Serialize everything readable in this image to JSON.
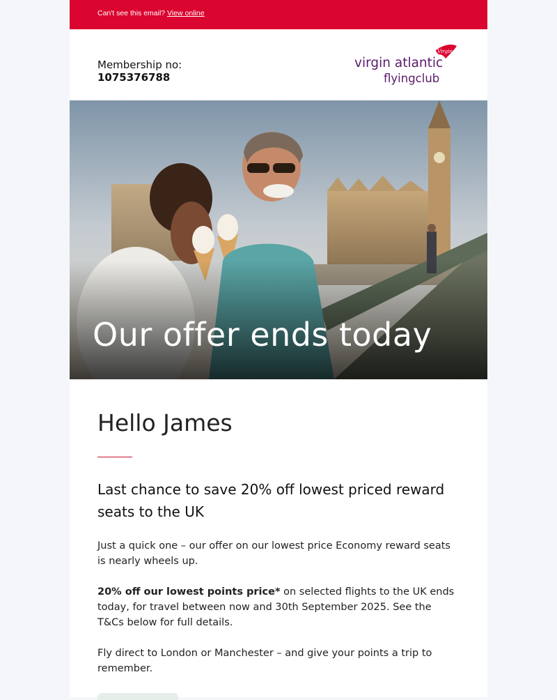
{
  "topbar": {
    "prefix": "Can't see this email?",
    "link": "View online"
  },
  "header": {
    "membership_label": "Membership no:",
    "membership_number": "1075376788",
    "logo": {
      "line1": "virgin atlantic",
      "line2": "flyingclub",
      "badge": "Virgin"
    }
  },
  "hero": {
    "title": "Our offer ends today"
  },
  "body": {
    "greeting": "Hello James",
    "subhead": "Last chance to save 20% off lowest priced reward seats to the UK",
    "paragraph1": "Just a quick one – our offer on our lowest price Economy reward seats is nearly wheels up.",
    "paragraph2_bold": "20% off our lowest points price*",
    "paragraph2_rest": " on selected flights to the UK ends today, for travel between now and 30th September 2025. See the T&Cs below for full details.",
    "paragraph3": "Fly direct to London or Manchester – and give your points a trip to remember."
  },
  "colors": {
    "brand_red": "#da0530",
    "logo_purple": "#5b1a6b",
    "rule_red": "#c8102e"
  }
}
